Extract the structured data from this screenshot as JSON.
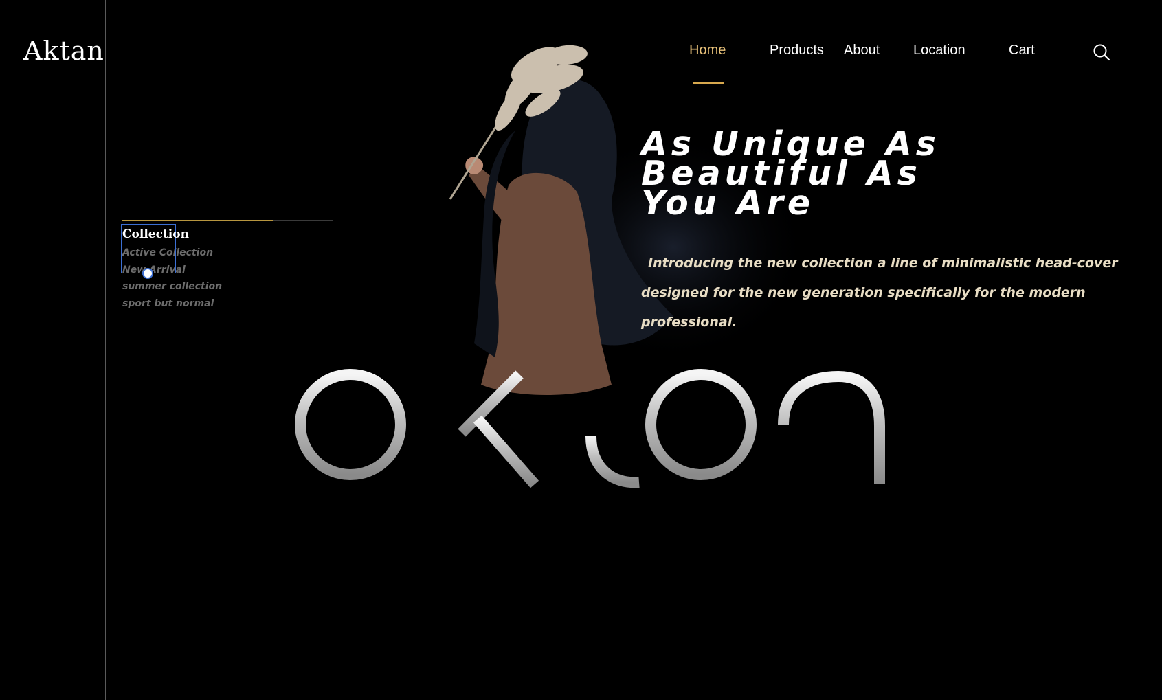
{
  "brand": {
    "name": "Aktan"
  },
  "nav": {
    "items": [
      {
        "label": "Home",
        "active": true
      },
      {
        "label": "Products"
      },
      {
        "label": "About"
      },
      {
        "label": "Location"
      },
      {
        "label": "Cart"
      }
    ],
    "search_icon": "search-icon"
  },
  "hero": {
    "headline": [
      "As Unique As",
      "Beautiful As",
      "You Are"
    ],
    "intro": [
      "Introducing the new collection  a line of minimalistic head-cover",
      "designed for the new generation specifically for the modern",
      "professional."
    ],
    "wordmark": "aktan"
  },
  "collection": {
    "title": "Collection",
    "items": [
      "Active Collection",
      "New Arrival",
      "summer collection",
      "sport but normal"
    ],
    "progress": 0.72
  },
  "colors": {
    "background": "#000000",
    "accent": "#d7a84e",
    "active_nav": "#e9c27a",
    "intro_text": "#e8ddc4",
    "muted_text": "#6c6c6c",
    "selection": "#3b6fd4"
  }
}
